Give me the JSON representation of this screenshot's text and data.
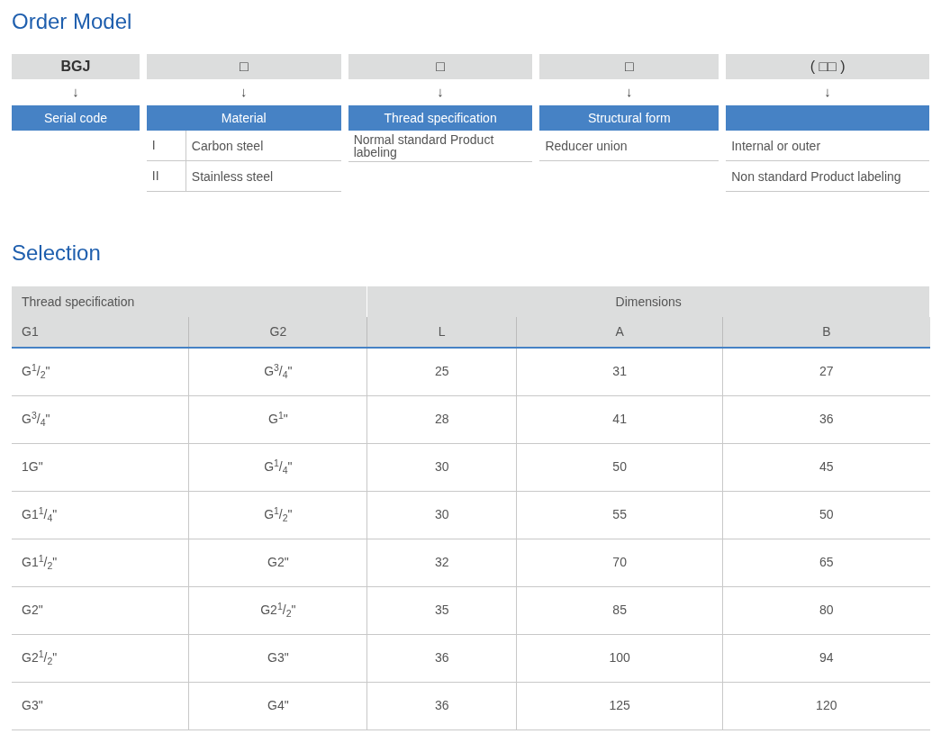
{
  "order_model": {
    "title": "Order Model",
    "columns": [
      {
        "code": "BGJ",
        "arrow": "↓",
        "heading": "Serial code"
      },
      {
        "code": "□",
        "arrow": "↓",
        "heading": "Material",
        "options": [
          {
            "code": "I",
            "text": "Carbon steel"
          },
          {
            "code": "II",
            "text": "Stainless steel"
          }
        ]
      },
      {
        "code": "□",
        "arrow": "↓",
        "heading": "Thread specification",
        "options": [
          {
            "text": "Normal standard Product labeling"
          }
        ]
      },
      {
        "code": "□",
        "arrow": "↓",
        "heading": "Structural form",
        "options": [
          {
            "text": "Reducer union"
          }
        ]
      },
      {
        "code": "( □□ )",
        "arrow": "↓",
        "options": [
          {
            "text": "Internal or outer"
          },
          {
            "text": "Non standard Product labeling"
          }
        ]
      }
    ]
  },
  "selection": {
    "title": "Selection",
    "group_headers": [
      {
        "label": "Thread specification"
      },
      {
        "label": "Dimensions"
      }
    ],
    "columns": [
      "G1",
      "G2",
      "L",
      "A",
      "B"
    ],
    "rows": [
      [
        "G$^{1}$/$_{2}$\"",
        "G$^{3}$/$_{4}$\"",
        "25",
        "31",
        "27"
      ],
      [
        "G$^{3}$/$_{4}$\"",
        "G$^{1}$\"",
        "28",
        "41",
        "36"
      ],
      [
        "1G\"",
        "G$^{1}$/$_{4}$\"",
        "30",
        "50",
        "45"
      ],
      [
        "G1$^{1}$/$_{4}$\"",
        "G$^{1}$/$_{2}$\"",
        "30",
        "55",
        "50"
      ],
      [
        "G1$^{1}$/$_{2}$\"",
        "G2\"",
        "32",
        "70",
        "65"
      ],
      [
        "G2\"",
        "G2$^{1}$/$_{2}$\"",
        "35",
        "85",
        "80"
      ],
      [
        "G2$^{1}$/$_{2}$\"",
        "G3\"",
        "36",
        "100",
        "94"
      ],
      [
        "G3\"",
        "G4\"",
        "36",
        "125",
        "120"
      ]
    ]
  }
}
